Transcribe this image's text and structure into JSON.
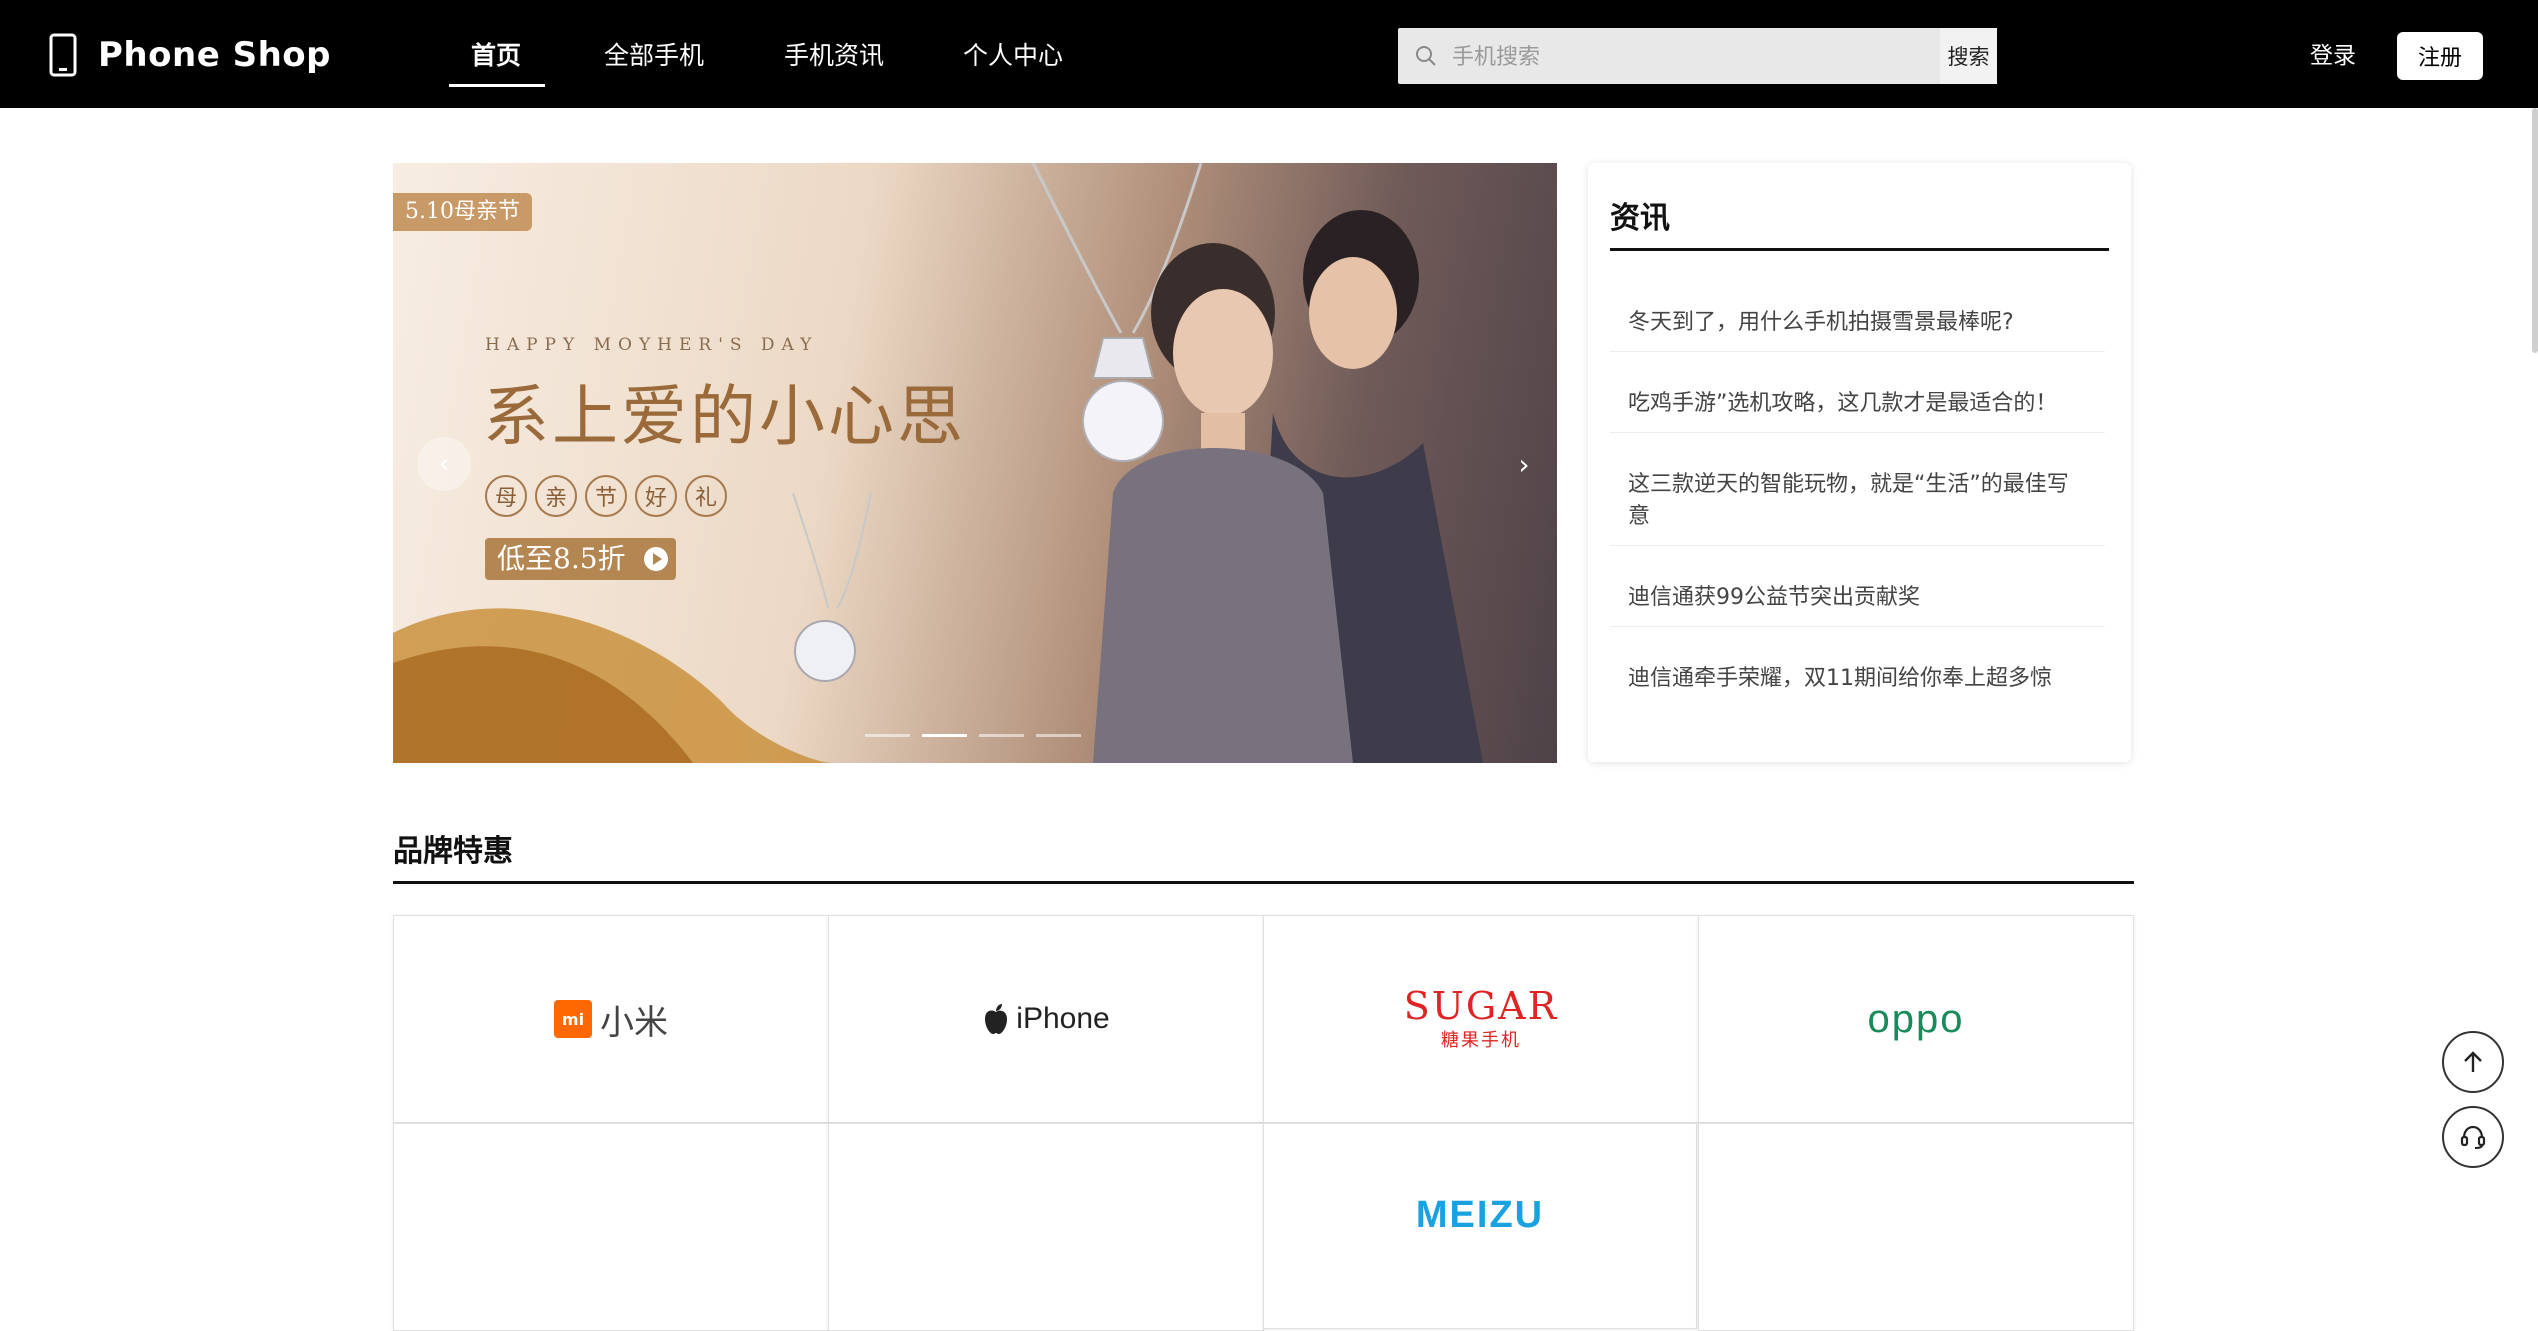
{
  "header": {
    "logo_text": "Phone Shop",
    "nav": [
      "首页",
      "全部手机",
      "手机资讯",
      "个人中心"
    ],
    "search_placeholder": "手机搜索",
    "search_button": "搜索",
    "login": "登录",
    "register": "注册"
  },
  "banner": {
    "tag": "5.10母亲节",
    "subtitle": "HAPPY MOYHER'S DAY",
    "title": "系上爱的小心思",
    "gift_chars": [
      "母",
      "亲",
      "节",
      "好",
      "礼"
    ],
    "price": "低至8.5折",
    "prev_arrow": "‹",
    "next_arrow": "›",
    "active_slide": 2,
    "slide_count": 4
  },
  "news": {
    "title": "资讯",
    "items": [
      "冬天到了，用什么手机拍摄雪景最棒呢?",
      "吃鸡手游”选机攻略，这几款才是最适合的！",
      "这三款逆天的智能玩物，就是“生活”的最佳写意",
      "迪信通获99公益节突出贡献奖",
      "迪信通牵手荣耀，双11期间给你奉上超多惊"
    ]
  },
  "brands": {
    "title": "品牌特惠",
    "items": [
      {
        "mark": "mi",
        "text": "小米"
      },
      {
        "text": "iPhone",
        "icon": "apple-icon"
      },
      {
        "text": "SUGAR",
        "sub": "糖果手机"
      },
      {
        "text": "oppo"
      },
      {
        "text": ""
      },
      {
        "text": ""
      },
      {
        "text": "MEIZU"
      },
      {
        "text": ""
      }
    ]
  },
  "colors": {
    "header_bg": "#000000",
    "mi_orange": "#ff6700",
    "sugar_red": "#e02424",
    "oppo_green": "#1a8a5a",
    "meizu_blue": "#1aa2e0"
  }
}
